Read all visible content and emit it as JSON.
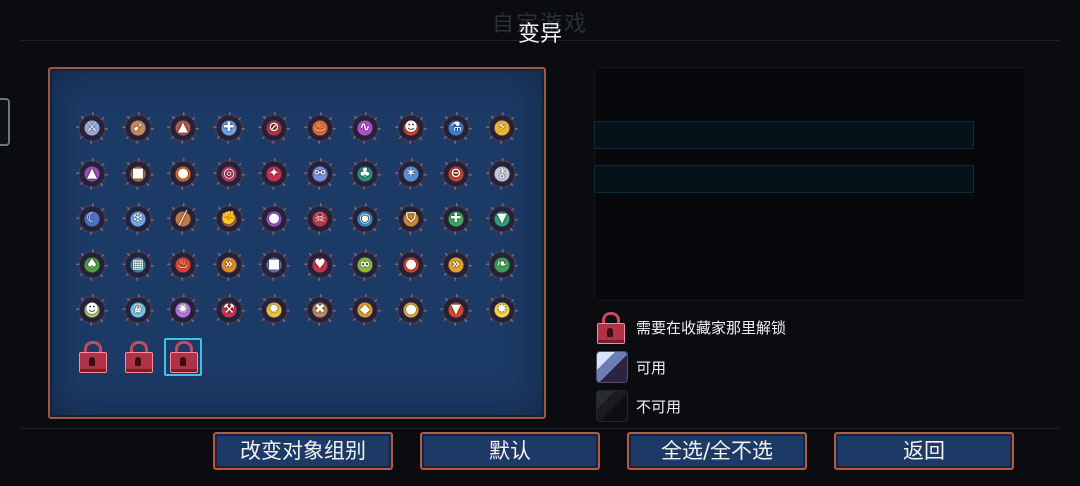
{
  "background_title": "自定游戏",
  "dialog": {
    "title": "变异"
  },
  "mutations": {
    "rows": [
      [
        {
          "icon": "sword-icon",
          "color": "#9aa9d6",
          "glyph": "⚔"
        },
        {
          "icon": "bow-icon",
          "color": "#c98a5a",
          "glyph": "➹"
        },
        {
          "icon": "trap-icon",
          "color": "#b55a4f",
          "glyph": "▲"
        },
        {
          "icon": "chainsaw-icon",
          "color": "#6fa3e6",
          "glyph": "✚"
        },
        {
          "icon": "crossed-circle-icon",
          "color": "#b8323e",
          "glyph": "⊘"
        },
        {
          "icon": "potion-icon",
          "color": "#e06a2b",
          "glyph": "♨"
        },
        {
          "icon": "whip-icon",
          "color": "#b24fd1",
          "glyph": "∿"
        },
        {
          "icon": "flame-skull-icon",
          "color": "#d9462d",
          "glyph": "☻"
        },
        {
          "icon": "flask-icon",
          "color": "#3f7fcf",
          "glyph": "⚗"
        },
        {
          "icon": "lightning-icon",
          "color": "#f0b330",
          "glyph": "⚡"
        }
      ],
      [
        {
          "icon": "wizard-hat-icon",
          "color": "#9d4fb0",
          "glyph": "▲"
        },
        {
          "icon": "backpack-icon",
          "color": "#b57a3f",
          "glyph": "■"
        },
        {
          "icon": "orb-icon",
          "color": "#e0702b",
          "glyph": "●"
        },
        {
          "icon": "target-icon",
          "color": "#c33b6a",
          "glyph": "◎"
        },
        {
          "icon": "compass-icon",
          "color": "#c93048",
          "glyph": "✦"
        },
        {
          "icon": "link-icon",
          "color": "#7c8fd6",
          "glyph": "⚯"
        },
        {
          "icon": "tree-icon",
          "color": "#2f8f7a",
          "glyph": "♣"
        },
        {
          "icon": "star-burst-icon",
          "color": "#5a8fd6",
          "glyph": "✶"
        },
        {
          "icon": "no-entry-icon",
          "color": "#c6452e",
          "glyph": "⊖"
        },
        {
          "icon": "key-icon",
          "color": "#c6c6d8",
          "glyph": "⚷"
        }
      ],
      [
        {
          "icon": "crescent-icon",
          "color": "#4d72c8",
          "glyph": "☾"
        },
        {
          "icon": "ice-icon",
          "color": "#6fa8e6",
          "glyph": "❄"
        },
        {
          "icon": "spear-icon",
          "color": "#c07a3f",
          "glyph": "╱"
        },
        {
          "icon": "fist-icon",
          "color": "#b5793f",
          "glyph": "✊"
        },
        {
          "icon": "drop-icon",
          "color": "#a64fd1",
          "glyph": "●"
        },
        {
          "icon": "skull-icon",
          "color": "#c9344a",
          "glyph": "☠"
        },
        {
          "icon": "eye-icon",
          "color": "#3f8fcf",
          "glyph": "◉"
        },
        {
          "icon": "shield-icon",
          "color": "#d08a2e",
          "glyph": "⛉"
        },
        {
          "icon": "heal-cross-icon",
          "color": "#3fa85a",
          "glyph": "✚"
        },
        {
          "icon": "fang-icon",
          "color": "#2f9f7a",
          "glyph": "▼"
        }
      ],
      [
        {
          "icon": "sprout-icon",
          "color": "#4f9f3f",
          "glyph": "♠"
        },
        {
          "icon": "gate-icon",
          "color": "#3f8fb0",
          "glyph": "▦"
        },
        {
          "icon": "fire-icon",
          "color": "#d9462d",
          "glyph": "♨"
        },
        {
          "icon": "speed-arrows-icon",
          "color": "#e08a2b",
          "glyph": "»"
        },
        {
          "icon": "armor-icon",
          "color": "#6b7fa8",
          "glyph": "■"
        },
        {
          "icon": "heart-icon",
          "color": "#c9344a",
          "glyph": "♥"
        },
        {
          "icon": "coil-icon",
          "color": "#8fb83f",
          "glyph": "∞"
        },
        {
          "icon": "tomato-icon",
          "color": "#e0482e",
          "glyph": "●"
        },
        {
          "icon": "dash-icon",
          "color": "#e0a32b",
          "glyph": "»"
        },
        {
          "icon": "leaf-icon",
          "color": "#3f9f4f",
          "glyph": "❧"
        }
      ],
      [
        {
          "icon": "mask-icon",
          "color": "#b6c96a",
          "glyph": "☻"
        },
        {
          "icon": "crown-icon",
          "color": "#6fc6e6",
          "glyph": "♛"
        },
        {
          "icon": "vortex-icon",
          "color": "#b874e6",
          "glyph": "✺"
        },
        {
          "icon": "axe-icon",
          "color": "#c9344a",
          "glyph": "⚒"
        },
        {
          "icon": "sun-icon",
          "color": "#f0c43a",
          "glyph": "✹"
        },
        {
          "icon": "bone-icon",
          "color": "#c08a5a",
          "glyph": "✖"
        },
        {
          "icon": "gem-icon",
          "color": "#e0a32b",
          "glyph": "◆"
        },
        {
          "icon": "bomb-icon",
          "color": "#f0b330",
          "glyph": "●"
        },
        {
          "icon": "blood-drop-icon",
          "color": "#d9462d",
          "glyph": "▼"
        },
        {
          "icon": "flash-icon",
          "color": "#f5d84a",
          "glyph": "✸"
        }
      ]
    ],
    "locked_count": 3
  },
  "legend": {
    "locked": "需要在收藏家那里解锁",
    "available": "可用",
    "unavailable": "不可用"
  },
  "buttons": {
    "change_group": "改变对象组别",
    "default": "默认",
    "select_all": "全选/全不选",
    "back": "返回"
  }
}
